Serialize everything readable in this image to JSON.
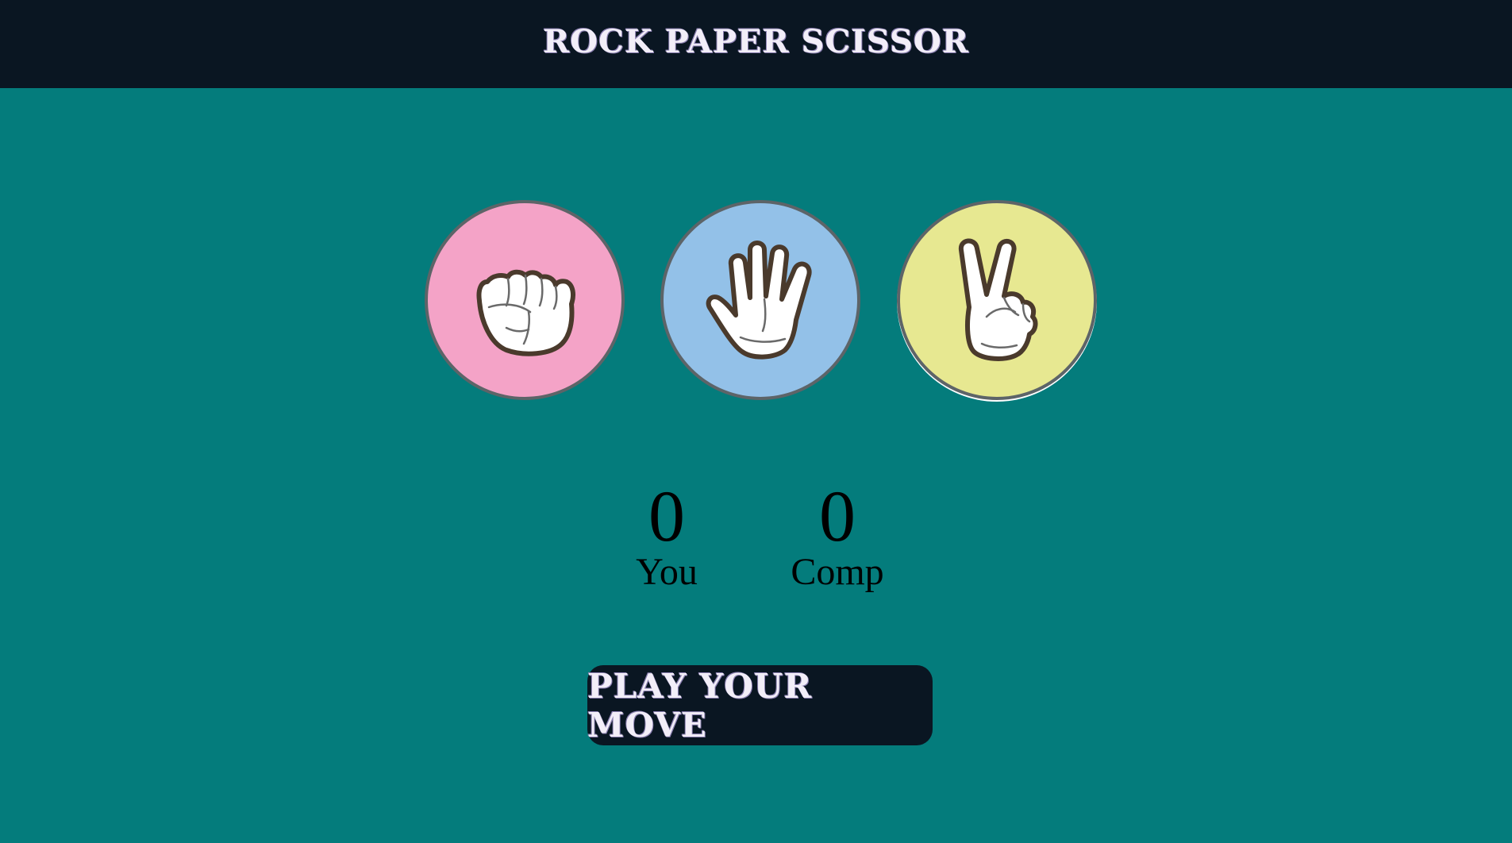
{
  "header": {
    "title": "ROCK PAPER SCISSOR"
  },
  "choices": [
    {
      "id": "rock",
      "icon": "fist-icon",
      "color": "#f4a3c7"
    },
    {
      "id": "paper",
      "icon": "open-hand-icon",
      "color": "#93c1e8"
    },
    {
      "id": "scissor",
      "icon": "peace-sign-icon",
      "color": "#e7e891"
    }
  ],
  "scoreboard": {
    "user_score": "0",
    "user_label": "You",
    "comp_score": "0",
    "comp_label": "Comp"
  },
  "play_button": {
    "label": "PLAY YOUR MOVE"
  },
  "colors": {
    "background": "#047c7c",
    "header_bg": "#0a1622",
    "button_bg": "#0a1622"
  }
}
